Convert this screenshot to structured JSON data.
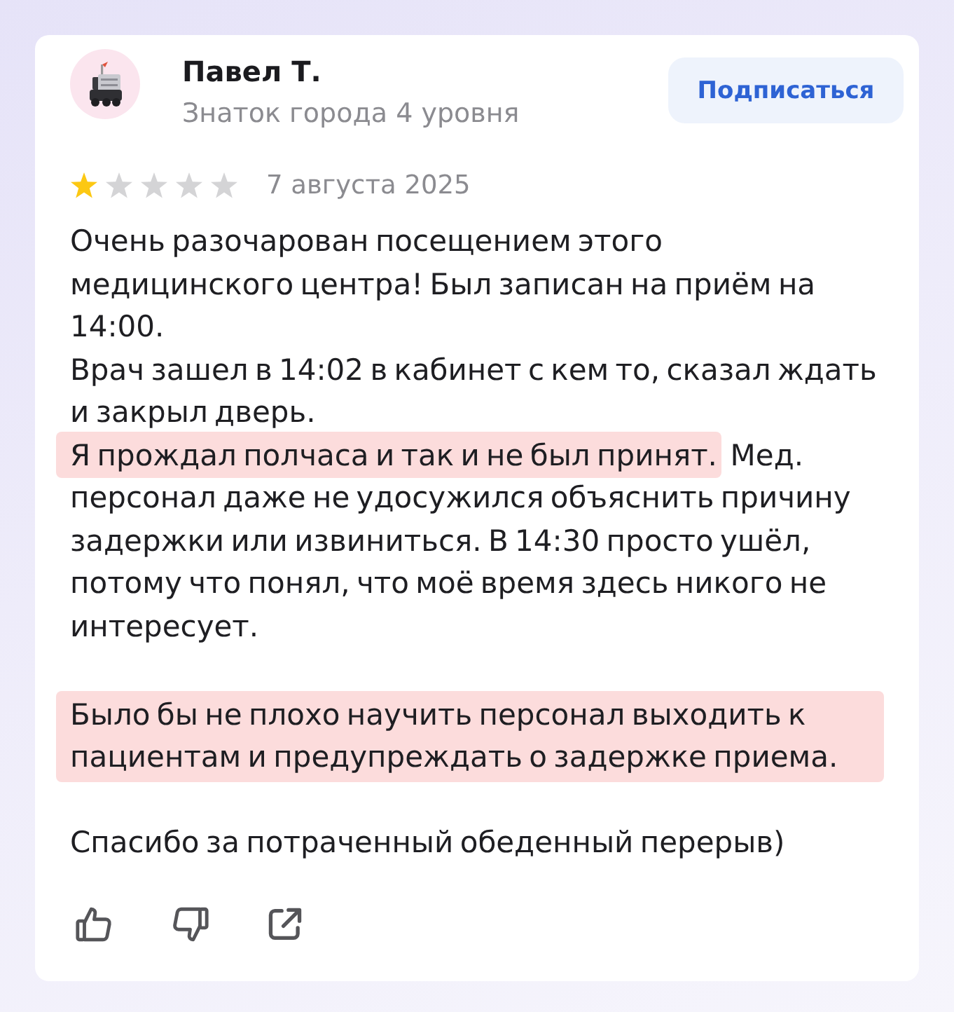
{
  "review": {
    "author": {
      "name": "Павел Т.",
      "subtitle": "Знаток города 4 уровня"
    },
    "subscribe_button": "Подписаться",
    "stars": 1,
    "date": "7 августа 2025",
    "text_blocks": [
      {
        "lines": [
          {
            "segments": [
              {
                "text": "Очень разочарован посещением этого медицинского центра! Был записан на приём на 14:00.",
                "highlighted": false
              }
            ]
          },
          {
            "segments": [
              {
                "text": "Врач зашел в 14:02 в кабинет с кем то, сказал ждать и закрыл дверь.",
                "highlighted": false
              }
            ]
          },
          {
            "segments": [
              {
                "text": "Я прождал полчаса и так и не был принят.",
                "highlighted": true
              },
              {
                "text": "Мед. персонал даже не удосужился объяснить причину задержки или извиниться. В 14:30 просто ушёл, потому что понял, что моё время здесь никого не интересует.",
                "highlighted": false
              }
            ]
          }
        ]
      },
      {
        "lines": [
          {
            "segments": [
              {
                "text": "Было бы не плохо научить персонал выходить к пациентам и предупреждать о задержке приема.",
                "highlighted": true
              }
            ]
          }
        ]
      },
      {
        "lines": [
          {
            "segments": [
              {
                "text": "Спасибо за потраченный обеденный перерыв)",
                "highlighted": false
              }
            ]
          }
        ]
      }
    ]
  }
}
